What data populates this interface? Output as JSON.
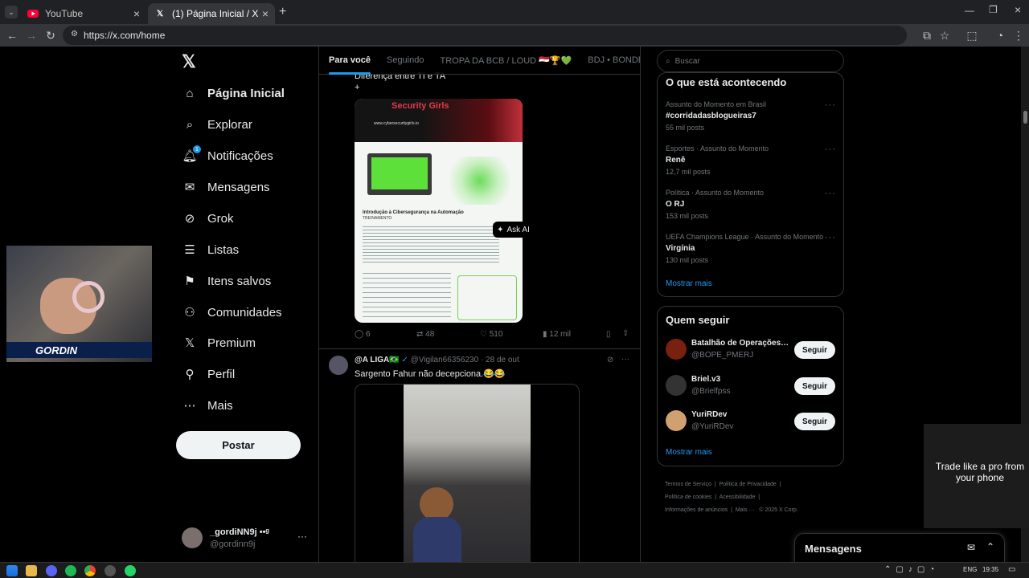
{
  "browser": {
    "tabs": [
      {
        "title": "YouTube"
      },
      {
        "title": "(1) Página Inicial / X"
      }
    ],
    "url": "https://x.com/home"
  },
  "nav": {
    "items": [
      {
        "label": "Página Inicial",
        "icon": "home-icon"
      },
      {
        "label": "Explorar",
        "icon": "search-icon"
      },
      {
        "label": "Notificações",
        "icon": "bell-icon",
        "badge": "1"
      },
      {
        "label": "Mensagens",
        "icon": "mail-icon"
      },
      {
        "label": "Grok",
        "icon": "grok-icon"
      },
      {
        "label": "Listas",
        "icon": "list-icon"
      },
      {
        "label": "Itens salvos",
        "icon": "bookmark-icon"
      },
      {
        "label": "Comunidades",
        "icon": "communities-icon"
      },
      {
        "label": "Premium",
        "icon": "x-logo-icon"
      },
      {
        "label": "Perfil",
        "icon": "person-icon"
      },
      {
        "label": "Mais",
        "icon": "more-circle-icon"
      }
    ],
    "post_label": "Postar",
    "account": {
      "name": "_gordiNN9j ••ᵍ",
      "handle": "@gordinn9j"
    }
  },
  "feed": {
    "tabs": [
      "Para você",
      "Seguindo",
      "TROPA DA BCB / LOUD 🇪🇬🏆💚",
      "BDJ • BONDE DO JO"
    ],
    "tweet1": {
      "text": "Diferença entre TI e TA",
      "plus": "+",
      "image_title": "Introdução à Cibersegurança na Automação",
      "image_sub": "TREINAMENTO",
      "image_brand": "Security Girls",
      "image_url": "www.cybersecuritygirls.io",
      "ask_ai": "Ask AI",
      "replies": "6",
      "reposts": "48",
      "likes": "510",
      "views": "12 mil"
    },
    "tweet2": {
      "name": "@A LIGA🇧🇷",
      "handle": "@Vigilan66356230",
      "date": "28 de out",
      "text": "Sargento Fahur não decepciona.😂😂"
    }
  },
  "sidebar": {
    "search_placeholder": "Buscar",
    "trends_title": "O que está acontecendo",
    "trends": [
      {
        "context": "Assunto do Momento em Brasil",
        "topic": "#corridadasblogueiras7",
        "count": "55 mil posts"
      },
      {
        "context": "Esportes · Assunto do Momento",
        "topic": "Renê",
        "count": "12,7 mil posts"
      },
      {
        "context": "Política · Assunto do Momento",
        "topic": "O RJ",
        "count": "153 mil posts"
      },
      {
        "context": "UEFA Champions League · Assunto do Momento",
        "topic": "Virgínia",
        "count": "130 mil posts"
      }
    ],
    "show_more": "Mostrar mais",
    "follow_title": "Quem seguir",
    "follow": [
      {
        "name": "Batalhão de Operações…",
        "handle": "@BOPE_PMERJ",
        "button": "Seguir"
      },
      {
        "name": "Briel.v3",
        "handle": "@Brielfpss",
        "button": "Seguir"
      },
      {
        "name": "YuriRDev",
        "handle": "@YuriRDev",
        "button": "Seguir"
      }
    ],
    "follow_more": "Mostrar mais",
    "footer": [
      "Termos de Serviço",
      "Política de Privacidade",
      "Política de cookies",
      "Acessibilidade",
      "Informações de anúncios",
      "Mais ···",
      "© 2025 X Corp."
    ]
  },
  "messages_label": "Mensagens",
  "ad": {
    "text": "Trade like a pro from your phone"
  },
  "webcam": {
    "overlay": "GORDIN"
  },
  "taskbar": {
    "lang": "ENG",
    "time": "19:35"
  }
}
